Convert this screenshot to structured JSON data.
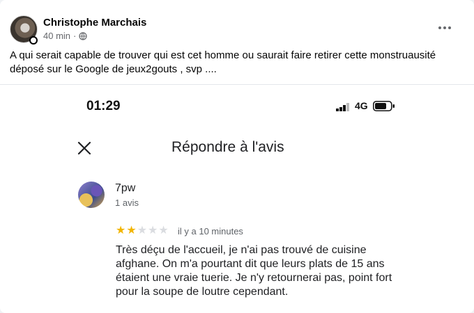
{
  "post": {
    "author": "Christophe Marchais",
    "time": "40 min",
    "separator": "·",
    "privacy_icon": "globe-icon",
    "more_icon": "more-horizontal-icon",
    "text": "A qui serait capable de trouver qui est cet homme ou saurait faire retirer cette monstruausité déposé sur le Google de jeux2gouts , svp ...."
  },
  "screenshot": {
    "status_bar": {
      "time": "01:29",
      "network": "4G",
      "signal_icon": "signal-bars-icon",
      "battery_icon": "battery-icon"
    },
    "header": {
      "title": "Répondre à l'avis",
      "close_icon": "close-icon"
    },
    "review": {
      "reviewer_name": "7pw",
      "reviewer_count": "1 avis",
      "rating": 2,
      "rating_max": 5,
      "time": "il y a 10 minutes",
      "text": "Très déçu de l'accueil, je n'ai pas trouvé de cuisine afghane. On m'a pourtant dit que leurs plats de 15 ans étaient une vraie tuerie. Je n'y retournerai pas, point fort pour la soupe de loutre cependant."
    }
  },
  "colors": {
    "star_on": "#f2b500",
    "star_off": "#dadce0",
    "text_secondary": "#65676b"
  }
}
